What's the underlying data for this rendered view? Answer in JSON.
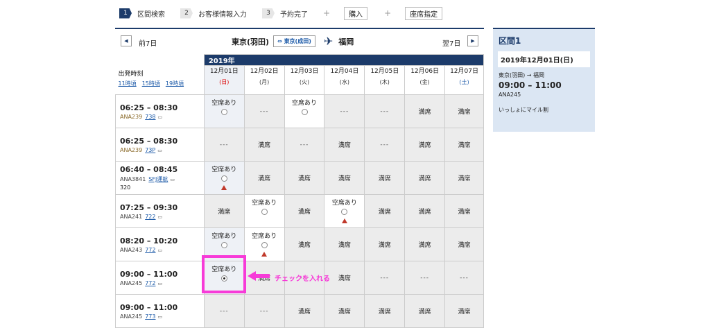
{
  "steps": [
    {
      "num": "1",
      "label": "区間検索"
    },
    {
      "num": "2",
      "label": "お客様情報入力"
    },
    {
      "num": "3",
      "label": "予約完了"
    }
  ],
  "plus": "+",
  "purchase_label": "購入",
  "seat_label": "座席指定",
  "nav": {
    "prev_label": "前7日",
    "next_label": "翌7日",
    "origin": "東京(羽田)",
    "alt_airport": "東京(成田)",
    "alt_icon": "⇔",
    "destination": "福岡"
  },
  "grid": {
    "year": "2019年",
    "departure_title": "出発時刻",
    "time_links": [
      "11時頃",
      "15時頃",
      "19時頃"
    ],
    "dates": [
      {
        "date": "12月01日",
        "dow": "(日)"
      },
      {
        "date": "12月02日",
        "dow": "(月)"
      },
      {
        "date": "12月03日",
        "dow": "(火)"
      },
      {
        "date": "12月04日",
        "dow": "(水)"
      },
      {
        "date": "12月05日",
        "dow": "(木)"
      },
      {
        "date": "12月06日",
        "dow": "(金)"
      },
      {
        "date": "12月07日",
        "dow": "(土)"
      }
    ],
    "avail_label": "空席あり",
    "full_label": "満席",
    "none_label": "---",
    "flights": [
      {
        "time": "06:25 – 08:30",
        "code": "ANA239",
        "link": "738",
        "extra": "",
        "cells": [
          {
            "s": "avail",
            "circle": true
          },
          {
            "s": "none"
          },
          {
            "s": "avail",
            "circle": true
          },
          {
            "s": "none"
          },
          {
            "s": "none"
          },
          {
            "s": "full"
          },
          {
            "s": "full"
          }
        ]
      },
      {
        "time": "06:25 – 08:30",
        "code": "ANA239",
        "link": "73P",
        "extra": "",
        "cells": [
          {
            "s": "none"
          },
          {
            "s": "full"
          },
          {
            "s": "none"
          },
          {
            "s": "full"
          },
          {
            "s": "none"
          },
          {
            "s": "full"
          },
          {
            "s": "full"
          }
        ]
      },
      {
        "time": "06:40 – 08:45",
        "code": "ANA3841",
        "link": "SFJ運航",
        "extra": "320",
        "cells": [
          {
            "s": "avail",
            "circle": true,
            "tri": true
          },
          {
            "s": "full"
          },
          {
            "s": "full"
          },
          {
            "s": "full"
          },
          {
            "s": "full"
          },
          {
            "s": "full"
          },
          {
            "s": "full"
          }
        ]
      },
      {
        "time": "07:25 – 09:30",
        "code": "ANA241",
        "link": "722",
        "extra": "",
        "cells": [
          {
            "s": "full"
          },
          {
            "s": "avail",
            "circle": true
          },
          {
            "s": "full"
          },
          {
            "s": "avail",
            "circle": true,
            "tri": true
          },
          {
            "s": "full"
          },
          {
            "s": "full"
          },
          {
            "s": "full"
          }
        ]
      },
      {
        "time": "08:20 – 10:20",
        "code": "ANA243",
        "link": "772",
        "extra": "",
        "cells": [
          {
            "s": "avail",
            "circle": true
          },
          {
            "s": "avail",
            "circle": true,
            "tri": true
          },
          {
            "s": "full"
          },
          {
            "s": "full"
          },
          {
            "s": "full"
          },
          {
            "s": "full"
          },
          {
            "s": "full"
          }
        ]
      },
      {
        "time": "09:00 – 11:00",
        "code": "ANA245",
        "link": "772",
        "extra": "",
        "cells": [
          {
            "s": "avail",
            "circle": true,
            "checked": true
          },
          {
            "s": "full"
          },
          {
            "s": "none"
          },
          {
            "s": "full"
          },
          {
            "s": "none"
          },
          {
            "s": "none"
          },
          {
            "s": "none"
          }
        ]
      },
      {
        "time": "09:00 – 11:00",
        "code": "ANA245",
        "link": "773",
        "extra": "",
        "cells": [
          {
            "s": "none"
          },
          {
            "s": "none"
          },
          {
            "s": "full"
          },
          {
            "s": "full"
          },
          {
            "s": "full"
          },
          {
            "s": "full"
          },
          {
            "s": "full"
          }
        ]
      }
    ]
  },
  "annotation": "チェックを入れる",
  "summary": {
    "title": "区間1",
    "date": "2019年12月01日(日)",
    "route": "東京(羽田) → 福岡",
    "time": "09:00 – 11:00",
    "flight": "ANA245",
    "fare": "いっしょにマイル割"
  },
  "colors": {
    "navy": "#1c3b6a",
    "annotation": "#f73bd8",
    "link": "#1c5aa8"
  }
}
